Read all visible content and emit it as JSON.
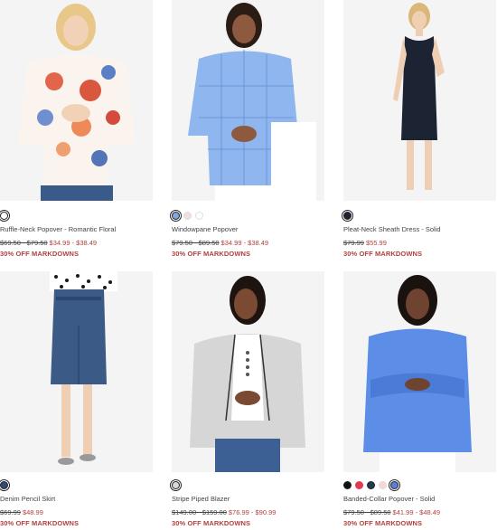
{
  "products": [
    {
      "name": "Ruffle-Neck Popover - Romantic Floral",
      "was_price": "$69.50 - $79.50",
      "now_price": "$34.99 - $38.49",
      "promo": "30% OFF MARKDOWNS",
      "swatches": [
        "#ffffff"
      ]
    },
    {
      "name": "Windowpane Popover",
      "was_price": "$79.50 - $89.50",
      "now_price": "$34.99 - $38.49",
      "promo": "30% OFF MARKDOWNS",
      "swatches": [
        "#7fa7e6",
        "#f3dede",
        "#ffffff"
      ]
    },
    {
      "name": "Pleat-Neck Sheath Dress - Solid",
      "was_price": "$79.99",
      "now_price": "$55.99",
      "promo": "30% OFF MARKDOWNS",
      "swatches": [
        "#1c2433"
      ]
    },
    {
      "name": "Denim Pencil Skirt",
      "was_price": "$69.99",
      "now_price": "$48.99",
      "promo": "30% OFF MARKDOWNS",
      "swatches": [
        "#2f4a7a"
      ]
    },
    {
      "name": "Stripe Piped Blazer",
      "was_price": "$149.00 - $159.00",
      "now_price": "$76.99 - $90.99",
      "promo": "30% OFF MARKDOWNS",
      "swatches": [
        "#d9d9d9"
      ]
    },
    {
      "name": "Banded-Collar Popover - Solid",
      "was_price": "$79.50 - $89.50",
      "now_price": "$41.99 - $48.49",
      "promo": "30% OFF MARKDOWNS",
      "swatches": [
        "#111111",
        "#e03a55",
        "#1e3d52",
        "#f6d9d3",
        "#5a7fe0"
      ]
    }
  ]
}
